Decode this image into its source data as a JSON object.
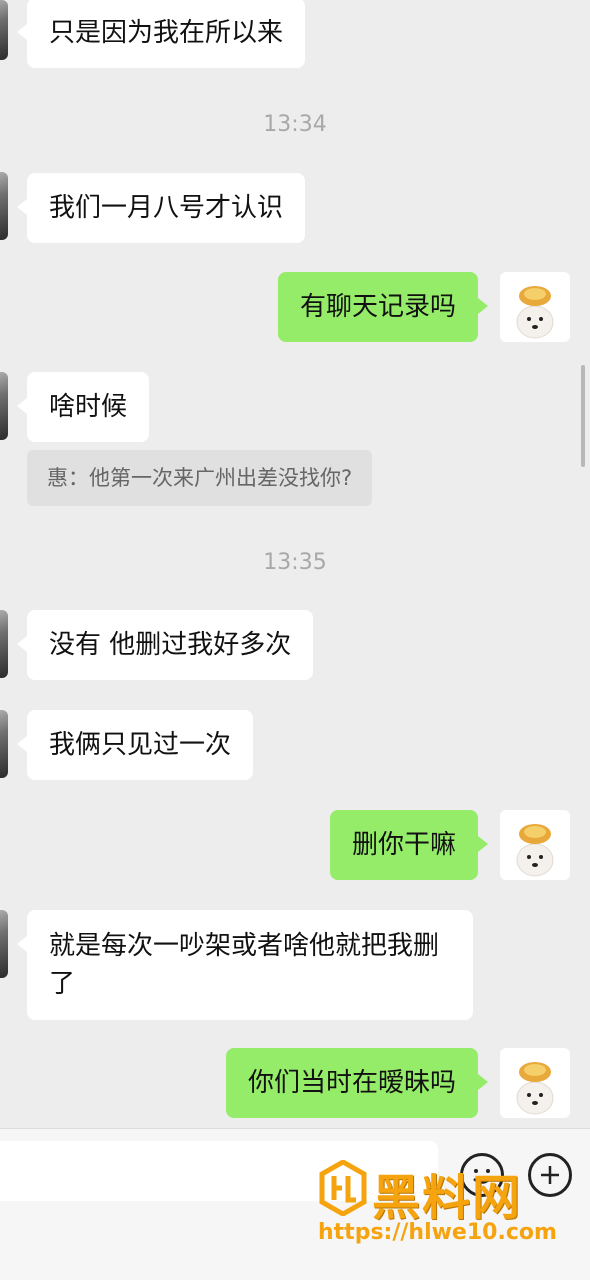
{
  "messages": [
    {
      "side": "in",
      "text": "只是因为我在所以来"
    },
    {
      "type": "time",
      "text": "13:34"
    },
    {
      "side": "in",
      "text": "我们一月八号才认识"
    },
    {
      "side": "out",
      "text": "有聊天记录吗"
    },
    {
      "side": "in",
      "text": "啥时候"
    },
    {
      "type": "quote",
      "text": "惠：他第一次来广州出差没找你?"
    },
    {
      "type": "time",
      "text": "13:35"
    },
    {
      "side": "in",
      "text": "没有 他删过我好多次"
    },
    {
      "side": "in",
      "text": "我俩只见过一次"
    },
    {
      "side": "out",
      "text": "删你干嘛"
    },
    {
      "side": "in",
      "text": "就是每次一吵架或者啥他就把我删了"
    },
    {
      "side": "out",
      "text": "你们当时在暧昧吗"
    }
  ],
  "watermark": {
    "title": "黑料网",
    "url": "https://hlwe10.com"
  },
  "colors": {
    "background": "#ededed",
    "incoming_bubble": "#ffffff",
    "outgoing_bubble": "#95ec69",
    "timestamp": "#a8a8a8",
    "watermark": "#f5a40f"
  }
}
